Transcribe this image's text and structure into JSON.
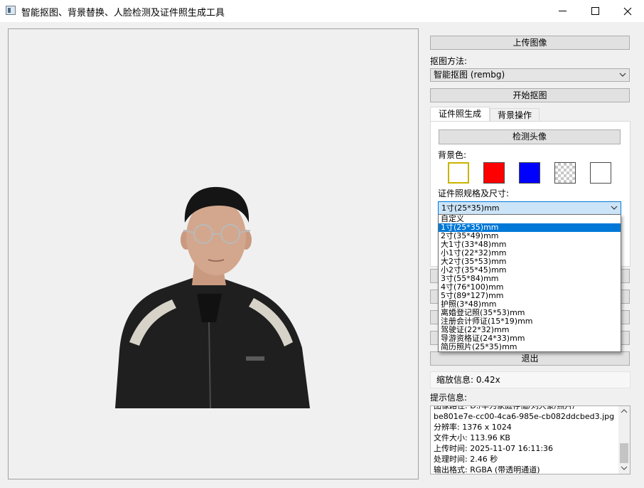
{
  "window": {
    "title": "智能抠图、背景替换、人脸检测及证件照生成工具"
  },
  "panel": {
    "upload_label": "上传图像",
    "method_label": "抠图方法:",
    "method_value": "智能抠图 (rembg)",
    "start_label": "开始抠图",
    "tabs": [
      "证件照生成",
      "背景操作"
    ],
    "detect_label": "检测头像",
    "bg_color_label": "背景色:",
    "swatches": [
      {
        "name": "yellow",
        "fill": "#ffffff",
        "border": "#c8b400"
      },
      {
        "name": "red",
        "fill": "#ff0000",
        "border": "#4a4a4a"
      },
      {
        "name": "blue",
        "fill": "#0000ff",
        "border": "#4a4a4a"
      },
      {
        "name": "transparent",
        "fill": "checker",
        "border": "#4a4a4a"
      },
      {
        "name": "white",
        "fill": "#ffffff",
        "border": "#4a4a4a"
      }
    ],
    "size_label": "证件照规格及尺寸:",
    "size_value": "1寸(25*35)mm",
    "size_options": [
      "自定义",
      "1寸(25*35)mm",
      "2寸(35*49)mm",
      "大1寸(33*48)mm",
      "小1寸(22*32)mm",
      "大2寸(35*53)mm",
      "小2寸(35*45)mm",
      "3寸(55*84)mm",
      "4寸(76*100)mm",
      "5寸(89*127)mm",
      "护照(3*48)mm",
      "离婚登记照(35*53)mm",
      "注册会计师证(15*19)mm",
      "驾驶证(22*32)mm",
      "导游资格证(24*33)mm",
      "简历照片(25*35)mm"
    ],
    "size_selected_index": 1,
    "exit_label": "退出",
    "zoom_info": "缩放信息: 0.42x",
    "info_label": "提示信息:",
    "info_lines": [
      "图像路径: D:/华为家庭存储/刘大豪/照片/",
      "be801e7e-cc00-4ca6-985e-cb082ddcbed3.jpg",
      "分辨率: 1376 x 1024",
      "文件大小: 113.96 KB",
      "上传时间: 2025-11-07 16:11:36",
      "处理时间: 2.46 秒",
      "输出格式: RGBA (带透明通道)"
    ]
  },
  "colors": {
    "selection": "#0078d7",
    "button": "#e1e1e1",
    "jacket": "#1f1f1f",
    "stripe": "#d7d3c8"
  }
}
